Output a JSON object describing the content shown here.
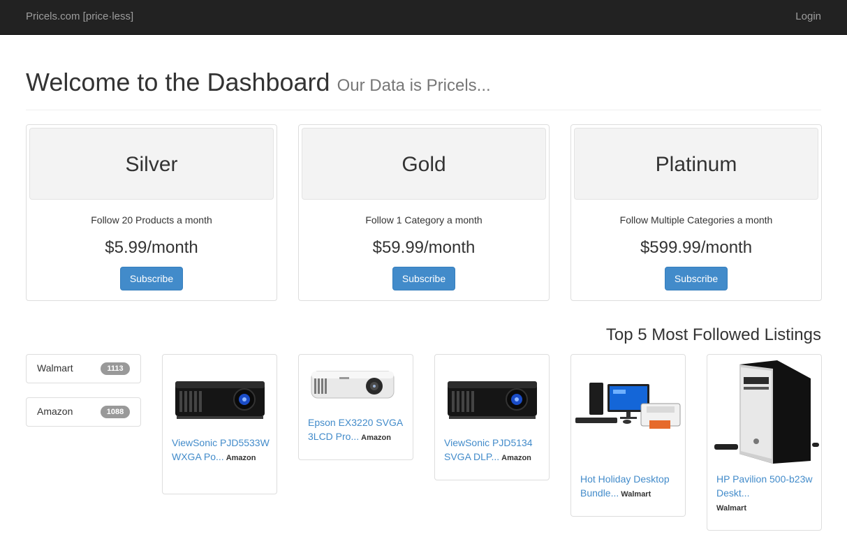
{
  "nav": {
    "brand": "Pricels.com [price·less]",
    "login": "Login"
  },
  "header": {
    "title": "Welcome to the Dashboard",
    "subtitle": "Our Data is Pricels..."
  },
  "plans": [
    {
      "name": "Silver",
      "description": "Follow 20 Products a month",
      "price": "$5.99/month",
      "button": "Subscribe"
    },
    {
      "name": "Gold",
      "description": "Follow 1 Category a month",
      "price": "$59.99/month",
      "button": "Subscribe"
    },
    {
      "name": "Platinum",
      "description": "Follow Multiple Categories a month",
      "price": "$599.99/month",
      "button": "Subscribe"
    }
  ],
  "listings_title": "Top 5 Most Followed Listings",
  "stores": [
    {
      "name": "Walmart",
      "count": "1113"
    },
    {
      "name": "Amazon",
      "count": "1088"
    }
  ],
  "listings": [
    {
      "title": "ViewSonic PJD5533W WXGA Po...",
      "store": "Amazon",
      "image": "projector-image"
    },
    {
      "title": "Epson EX3220 SVGA 3LCD Pro...",
      "store": "Amazon",
      "image": "projector-image"
    },
    {
      "title": "ViewSonic PJD5134 SVGA DLP...",
      "store": "Amazon",
      "image": "projector-image"
    },
    {
      "title": "Hot Holiday Desktop Bundle...",
      "store": "Walmart",
      "image": "desktop-bundle-image"
    },
    {
      "title": "HP Pavilion 500-b23w Deskt...",
      "store": "Walmart",
      "image": "desktop-tower-image"
    }
  ],
  "colors": {
    "navbar": "#222222",
    "primary": "#428bca",
    "badge": "#999999",
    "link": "#428bca"
  }
}
